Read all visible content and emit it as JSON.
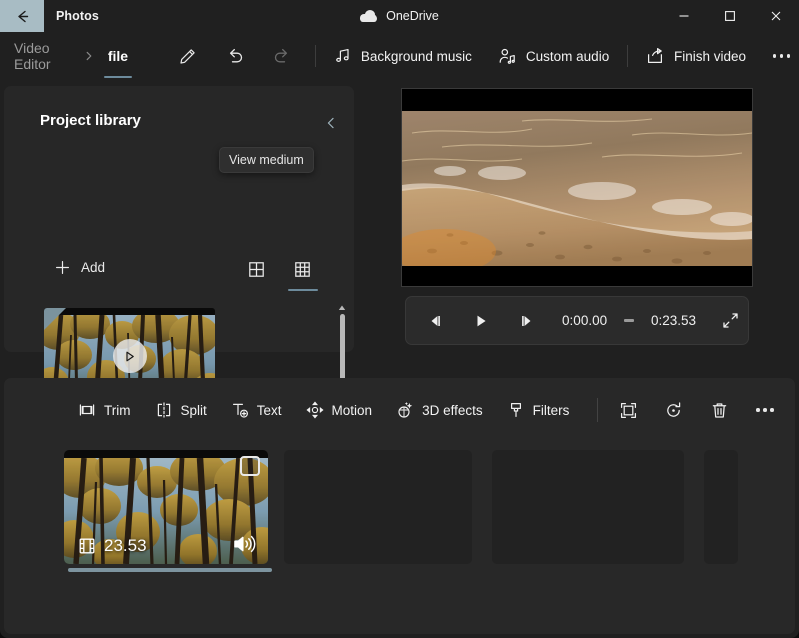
{
  "titlebar": {
    "back_icon": "arrow-left-icon",
    "app_title": "Photos",
    "cloud_label": "OneDrive",
    "cloud_icon": "onedrive-cloud-icon",
    "minimize_icon": "minimize-icon",
    "maximize_icon": "maximize-icon",
    "close_icon": "close-icon"
  },
  "commandbar": {
    "breadcrumb_root": "Video Editor",
    "breadcrumb_separator_icon": "chevron-right-icon",
    "project_name": "file",
    "rename_icon": "pencil-icon",
    "undo_icon": "undo-icon",
    "redo_icon": "redo-icon",
    "background_music": "Background music",
    "background_music_icon": "music-note-icon",
    "custom_audio": "Custom audio",
    "custom_audio_icon": "person-audio-icon",
    "finish_video": "Finish video",
    "finish_video_icon": "share-export-icon",
    "more_icon": "more-options-icon"
  },
  "library": {
    "title": "Project library",
    "collapse_icon": "chevron-left-icon",
    "add_label": "Add",
    "add_icon": "plus-icon",
    "tooltip": "View medium",
    "view_large_icon": "grid-2x2-icon",
    "view_medium_icon": "grid-3x3-icon",
    "view_medium_selected": true,
    "thumbnail": {
      "name": "forest-video-thumbnail",
      "play_icon": "play-triangle-icon",
      "corner_flag": "selected-corner-flag"
    },
    "scrollbar": {
      "up_icon": "scroll-up-arrow-icon",
      "down_icon": "scroll-down-arrow-icon"
    }
  },
  "preview": {
    "name": "beach-sunset-frame",
    "controls": {
      "prev_frame_icon": "previous-frame-icon",
      "play_icon": "play-icon",
      "next_frame_icon": "next-frame-icon",
      "current_time": "0:00.00",
      "separator": "-",
      "total_time": "0:23.53",
      "fullscreen_icon": "fullscreen-icon"
    }
  },
  "timeline": {
    "tools": [
      {
        "label": "Trim",
        "icon": "trim-icon"
      },
      {
        "label": "Split",
        "icon": "split-icon"
      },
      {
        "label": "Text",
        "icon": "text-add-icon"
      },
      {
        "label": "Motion",
        "icon": "motion-icon"
      },
      {
        "label": "3D effects",
        "icon": "3d-effects-icon"
      },
      {
        "label": "Filters",
        "icon": "filters-brush-icon"
      }
    ],
    "icon_tools": [
      {
        "icon": "aspect-ratio-icon"
      },
      {
        "icon": "rotate-icon"
      },
      {
        "icon": "delete-trash-icon"
      },
      {
        "icon": "more-options-icon"
      }
    ],
    "clip": {
      "duration": "23.53",
      "film_icon": "film-strip-icon",
      "audio_icon": "speaker-volume-icon",
      "checkbox_icon": "checkbox-unchecked-icon",
      "selected": true
    }
  },
  "colors": {
    "accent": "#6d8b9c",
    "selection_bar": "#7d949f",
    "back_button_bg": "#a8bcc4",
    "panel_bg": "#272727",
    "window_bg": "#202020"
  }
}
